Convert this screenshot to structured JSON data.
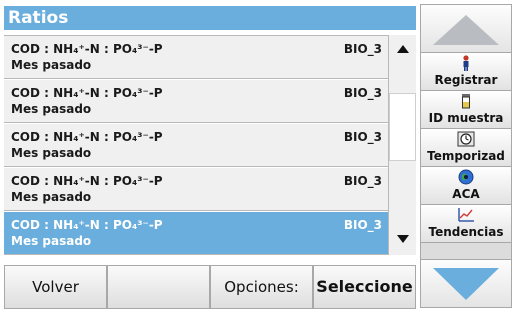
{
  "title": "Ratios",
  "list": {
    "rows": [
      {
        "line1": "COD : NH₄⁺-N : PO₄³⁻-P",
        "line2": "Mes pasado",
        "code": "BIO_3",
        "selected": false
      },
      {
        "line1": "COD : NH₄⁺-N : PO₄³⁻-P",
        "line2": "Mes pasado",
        "code": "BIO_3",
        "selected": false
      },
      {
        "line1": "COD : NH₄⁺-N : PO₄³⁻-P",
        "line2": "Mes pasado",
        "code": "BIO_3",
        "selected": false
      },
      {
        "line1": "COD : NH₄⁺-N : PO₄³⁻-P",
        "line2": "Mes pasado",
        "code": "BIO_3",
        "selected": false
      },
      {
        "line1": "COD : NH₄⁺-N : PO₄³⁻-P",
        "line2": "Mes pasado",
        "code": "BIO_3",
        "selected": true
      }
    ]
  },
  "scrollbar": {
    "up_icon": "triangle-up-icon",
    "down_icon": "triangle-down-icon"
  },
  "sidebar": {
    "up_icon": "large-up-arrow-icon",
    "down_icon": "large-down-arrow-icon",
    "buttons": [
      {
        "label": "Registrar",
        "icon": "person-icon"
      },
      {
        "label": "ID muestra",
        "icon": "sample-vial-icon"
      },
      {
        "label": "Temporizad",
        "icon": "timer-icon"
      },
      {
        "label": "ACA",
        "icon": "globe-icon"
      },
      {
        "label": "Tendencias",
        "icon": "trend-chart-icon"
      }
    ]
  },
  "bottom": {
    "back_label": "Volver",
    "options_label": "Opciones:",
    "select_label": "Seleccione"
  },
  "colors": {
    "accent": "#6aaedd",
    "row_bg": "#f0f0f0",
    "panel_bg": "#dcdcdc"
  }
}
